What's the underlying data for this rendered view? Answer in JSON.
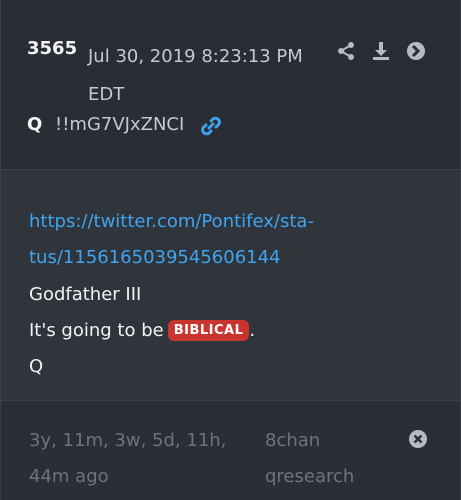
{
  "post": {
    "number": "3565",
    "date": "Jul 30, 2019 8:23:13 PM EDT",
    "author": "Q",
    "tripcode": "!!mG7VJxZNCI"
  },
  "actions": {
    "share_icon": "share-icon",
    "download_icon": "download-icon",
    "forward_icon": "arrow-right-circle-icon",
    "link_icon": "link-icon"
  },
  "body": {
    "link_line1": "https://twitter.com/Pontifex/sta-",
    "link_line2": "tus/1156165039545606144",
    "line3": "Godfather III",
    "line4_prefix": "It's going to be",
    "badge": "BIBLICAL",
    "line4_suffix": ".",
    "line5": "Q"
  },
  "footer": {
    "ago": "3y, 11m, 3w, 5d, 11h, 44m ago",
    "board": "8chan qresearch",
    "close_icon": "close-circle-icon"
  },
  "colors": {
    "background": "#2b2e35",
    "body_background": "#30353c",
    "link": "#3fa4f0",
    "badge": "#c8352f",
    "muted": "#6e737c"
  }
}
